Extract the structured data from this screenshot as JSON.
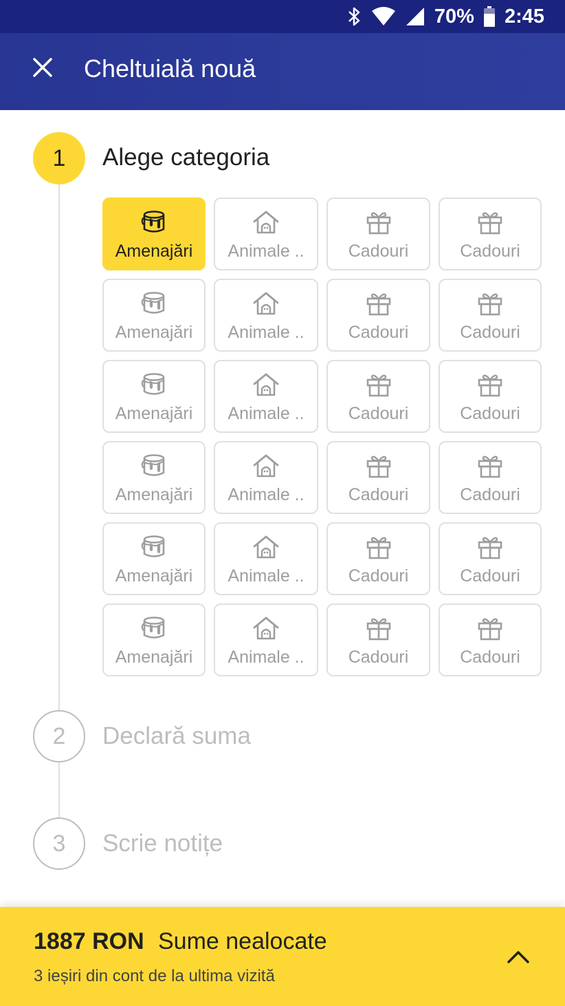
{
  "status_bar": {
    "battery": "70%",
    "time": "2:45",
    "icons": [
      "bluetooth-icon",
      "wifi-icon",
      "signal-icon",
      "battery-icon"
    ]
  },
  "app_bar": {
    "title": "Cheltuială nouă",
    "close_icon": "close-icon"
  },
  "steps": [
    {
      "number": "1",
      "title": "Alege categoria",
      "state": "active"
    },
    {
      "number": "2",
      "title": "Declară suma",
      "state": "inactive"
    },
    {
      "number": "3",
      "title": "Scrie notițe",
      "state": "inactive"
    }
  ],
  "categories": {
    "selected": "Amenajări",
    "rows": [
      [
        {
          "label": "Amenajări",
          "icon": "paint-bucket-icon"
        },
        {
          "label": "Animale ..",
          "icon": "dog-house-icon"
        },
        {
          "label": "Cadouri",
          "icon": "gift-icon"
        },
        {
          "label": "Cadouri",
          "icon": "gift-icon"
        }
      ],
      [
        {
          "label": "Amenajări",
          "icon": "paint-bucket-icon"
        },
        {
          "label": "Animale ..",
          "icon": "dog-house-icon"
        },
        {
          "label": "Cadouri",
          "icon": "gift-icon"
        },
        {
          "label": "Cadouri",
          "icon": "gift-icon"
        }
      ],
      [
        {
          "label": "Amenajări",
          "icon": "paint-bucket-icon"
        },
        {
          "label": "Animale ..",
          "icon": "dog-house-icon"
        },
        {
          "label": "Cadouri",
          "icon": "gift-icon"
        },
        {
          "label": "Cadouri",
          "icon": "gift-icon"
        }
      ],
      [
        {
          "label": "Amenajări",
          "icon": "paint-bucket-icon"
        },
        {
          "label": "Animale ..",
          "icon": "dog-house-icon"
        },
        {
          "label": "Cadouri",
          "icon": "gift-icon"
        },
        {
          "label": "Cadouri",
          "icon": "gift-icon"
        }
      ],
      [
        {
          "label": "Amenajări",
          "icon": "paint-bucket-icon"
        },
        {
          "label": "Animale ..",
          "icon": "dog-house-icon"
        },
        {
          "label": "Cadouri",
          "icon": "gift-icon"
        },
        {
          "label": "Cadouri",
          "icon": "gift-icon"
        }
      ],
      [
        {
          "label": "Amenajări",
          "icon": "paint-bucket-icon"
        },
        {
          "label": "Animale ..",
          "icon": "dog-house-icon"
        },
        {
          "label": "Cadouri",
          "icon": "gift-icon"
        },
        {
          "label": "Cadouri",
          "icon": "gift-icon"
        }
      ]
    ]
  },
  "bottom_sheet": {
    "amount": "1887 RON",
    "amount_label": "Sume nealocate",
    "subtitle": "3 ieșiri din cont de la ultima vizită",
    "expand_icon": "chevron-up-icon"
  },
  "colors": {
    "status_bar": "#1a237e",
    "app_bar": "#283593",
    "accent": "#fdd835",
    "inactive": "#bdbdbd",
    "tile_border": "#e0e0e0"
  }
}
